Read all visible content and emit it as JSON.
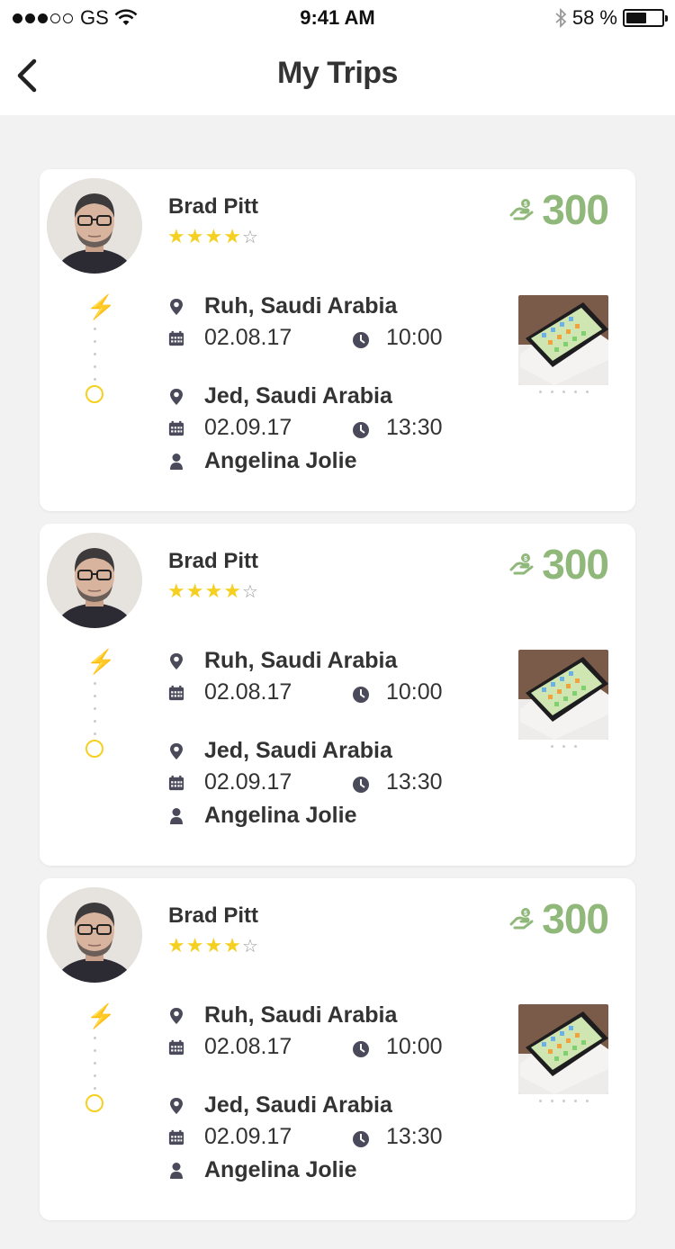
{
  "status_bar": {
    "carrier": "GS",
    "time": "9:41 AM",
    "battery_text": "58 %",
    "battery_level": 0.58
  },
  "nav": {
    "title": "My Trips",
    "back_icon": "chevron-left-icon"
  },
  "colors": {
    "accent_yellow": "#f5d020",
    "price_green": "#8fb87a",
    "icon_gray": "#4a4a5a"
  },
  "trips": [
    {
      "driver_name": "Brad Pitt",
      "rating": 4,
      "rating_max": 5,
      "price": "300",
      "from_location": "Ruh, Saudi Arabia",
      "from_date": "02.08.17",
      "from_time": "10:00",
      "to_location": "Jed, Saudi Arabia",
      "to_date": "02.09.17",
      "to_time": "13:30",
      "passenger": "Angelina Jolie",
      "thumb_dot_count": 5
    },
    {
      "driver_name": "Brad Pitt",
      "rating": 4,
      "rating_max": 5,
      "price": "300",
      "from_location": "Ruh, Saudi Arabia",
      "from_date": "02.08.17",
      "from_time": "10:00",
      "to_location": "Jed, Saudi Arabia",
      "to_date": "02.09.17",
      "to_time": "13:30",
      "passenger": "Angelina Jolie",
      "thumb_dot_count": 3
    },
    {
      "driver_name": "Brad Pitt",
      "rating": 4,
      "rating_max": 5,
      "price": "300",
      "from_location": "Ruh, Saudi Arabia",
      "from_date": "02.08.17",
      "from_time": "10:00",
      "to_location": "Jed, Saudi Arabia",
      "to_date": "02.09.17",
      "to_time": "13:30",
      "passenger": "Angelina Jolie",
      "thumb_dot_count": 5
    }
  ]
}
